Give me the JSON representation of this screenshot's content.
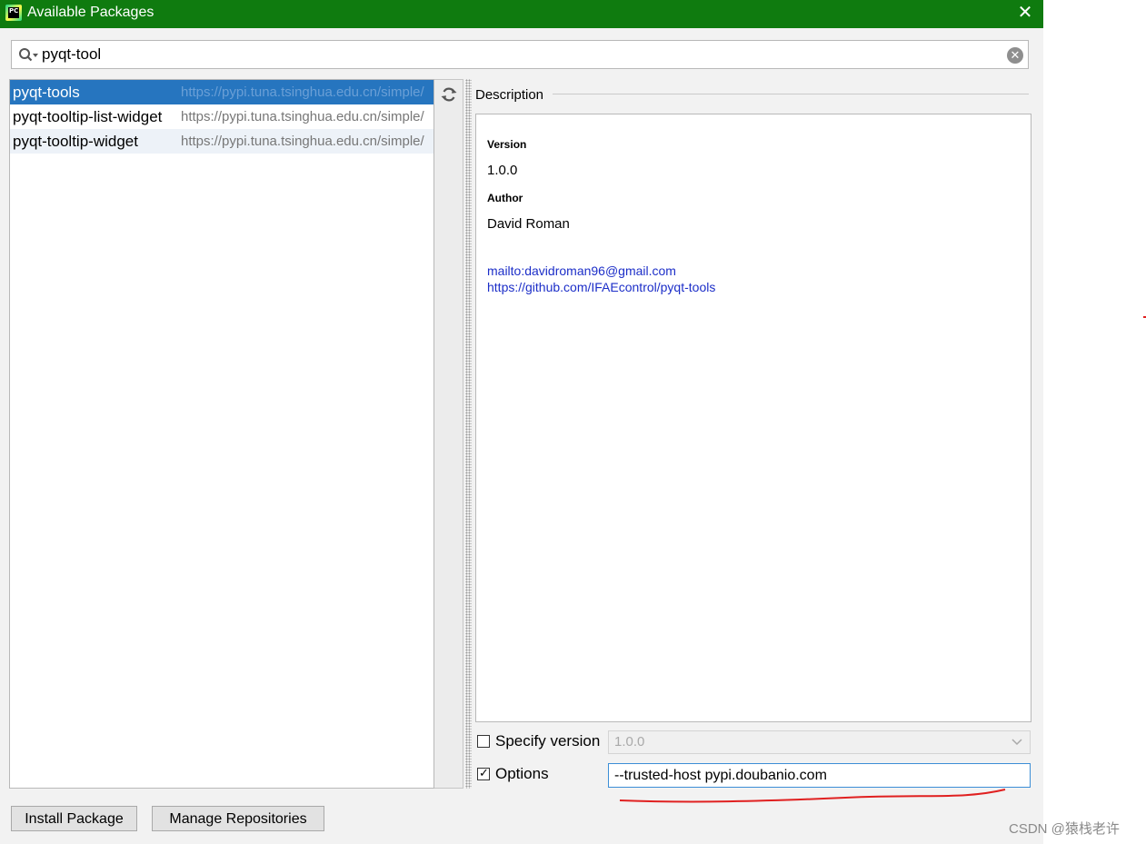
{
  "window": {
    "title": "Available Packages",
    "icon_text": "PC",
    "close_glyph": "✕",
    "titlebar_color": "#0f7b0f"
  },
  "search": {
    "value": "pyqt-tool",
    "icon": "search-icon",
    "clear_icon": "clear-icon",
    "clear_glyph": "✕"
  },
  "packages": [
    {
      "name": "pyqt-tools",
      "repo": "https://pypi.tuna.tsinghua.edu.cn/simple/",
      "selected": true
    },
    {
      "name": "pyqt-tooltip-list-widget",
      "repo": "https://pypi.tuna.tsinghua.edu.cn/simple/",
      "selected": false
    },
    {
      "name": "pyqt-tooltip-widget",
      "repo": "https://pypi.tuna.tsinghua.edu.cn/simple/",
      "selected": false
    }
  ],
  "toolstrip": {
    "refresh_icon": "refresh-icon"
  },
  "description": {
    "label": "Description",
    "version_heading": "Version",
    "version_value": "1.0.0",
    "author_heading": "Author",
    "author_value": "David Roman",
    "links": [
      "mailto:davidroman96@gmail.com",
      "https://github.com/IFAEcontrol/pyqt-tools"
    ]
  },
  "specify_version": {
    "label": "Specify version",
    "checked": false,
    "selected_value": "1.0.0",
    "enabled": false
  },
  "options": {
    "label": "Options",
    "checked": true,
    "value": "--trusted-host pypi.doubanio.com"
  },
  "buttons": {
    "install": "Install Package",
    "manage": "Manage Repositories"
  },
  "colors": {
    "selection": "#2675bf",
    "link": "#1c2ec8",
    "annotation": "#e02020"
  },
  "watermark": "CSDN @猿栈老许"
}
